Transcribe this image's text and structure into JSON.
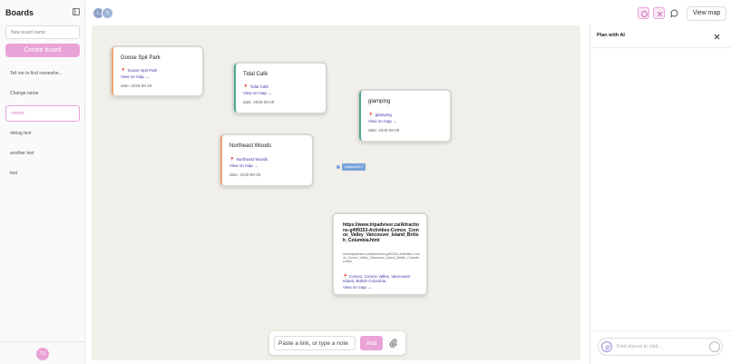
{
  "sidebar": {
    "title": "Boards",
    "new_board_placeholder": "New board name",
    "create_label": "Create board",
    "items": [
      {
        "label": "Tell me to find somewhe..."
      },
      {
        "label": "Change name"
      },
      {
        "label": "comox"
      },
      {
        "label": "debug test"
      },
      {
        "label": "another test"
      },
      {
        "label": "test"
      }
    ],
    "active_item": "comox",
    "user_initials": "TU"
  },
  "topbar": {
    "collaborators": [
      "L",
      "T"
    ],
    "view_map_label": "View map",
    "icons": [
      "location-pin-icon",
      "plan-icon",
      "chat-icon"
    ]
  },
  "cards": [
    {
      "title": "Goose Spit Park",
      "location": "Goose Spit Park",
      "map_link": "View on map →",
      "date": "date: 2026-08-29",
      "accent": "orange"
    },
    {
      "title": "Tidal Café",
      "location": "Tidal Café",
      "map_link": "View on map →",
      "date": "date: 2026-08-09",
      "accent": "teal"
    },
    {
      "title": "glamping",
      "location": "glamping",
      "map_link": "View on map →",
      "date": "date: 2026-08-09",
      "accent": "teal"
    },
    {
      "title": "Northeast Woods",
      "location": "Northeast Woods",
      "map_link": "View on map →",
      "date": "date: 2026-08-29",
      "accent": "orange"
    }
  ],
  "marker": {
    "label": "traktor9317"
  },
  "link_card": {
    "url": "https://www.tripadvisor.ca/Attractions-g499153-Activities-Comox_Comox_Valley_Vancouver_Island_British_Columbia.html",
    "url_secondary": "www.tripadvisor.ca/Attractions-g499153-Activities-Comox_Comox_Valley_Vancouver_Island_British_Columbia.html",
    "location": "Comox, Comox Valley, Vancouver Island, British Columbia",
    "map_link": "View on map →"
  },
  "composer": {
    "placeholder": "Paste a link, or type a note",
    "add_label": "Add"
  },
  "plan_panel": {
    "title": "Plan with AI",
    "input_placeholder": "Find places to visit..."
  },
  "colors": {
    "accent_pink": "#eaa3d7",
    "link_blue": "#3d3aa8",
    "canvas_bg": "#f1efe9",
    "orange_accent": "#f0a070",
    "teal_accent": "#4aa58c"
  }
}
